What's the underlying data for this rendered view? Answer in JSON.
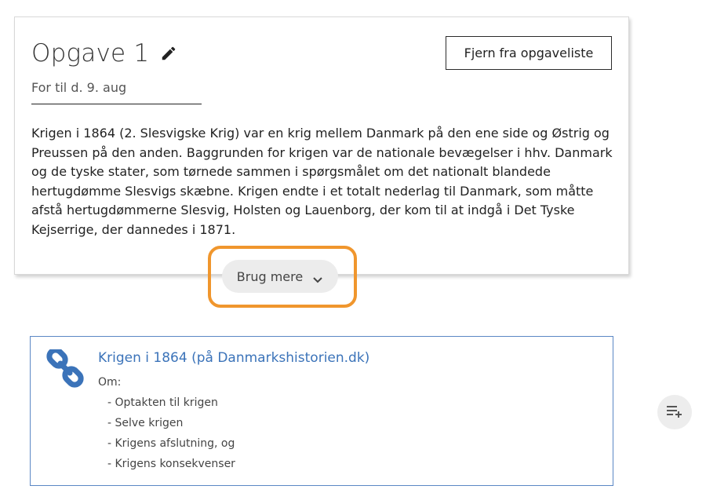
{
  "task": {
    "title": "Opgave 1",
    "remove_label": "Fjern fra opgaveliste",
    "due": "For til d. 9. aug",
    "description": "Krigen i 1864 (2. Slesvigske Krig) var en krig mellem Danmark på den ene side og Østrig og Preussen på den anden. Baggrunden for krigen var de nationale bevægelser i hhv. Danmark og de tyske stater, som tørnede sammen i spørgsmålet om det nationalt blandede hertugdømme Slesvigs skæbne. Krigen endte i et totalt nederlag til Danmark, som måtte afstå hertugdømmerne Slesvig, Holsten og Lauenborg, der kom til at indgå i Det Tyske Kejserrige, der dannedes i 1871.",
    "more_label": "Brug mere"
  },
  "resource": {
    "title": "Krigen i 1864 (på Danmarkshistorien.dk)",
    "about_label": "Om:",
    "items": [
      "- Optakten til krigen",
      "- Selve krigen",
      "- Krigens afslutning, og",
      "- Krigens konsekvenser"
    ]
  },
  "icons": {
    "edit": "pencil-icon",
    "expand": "chevron-down-icon",
    "link": "link-icon",
    "queue": "playlist-add-icon"
  },
  "colors": {
    "highlight": "#f0962d",
    "link": "#3b73b9",
    "resource_border": "#5b87c5"
  }
}
